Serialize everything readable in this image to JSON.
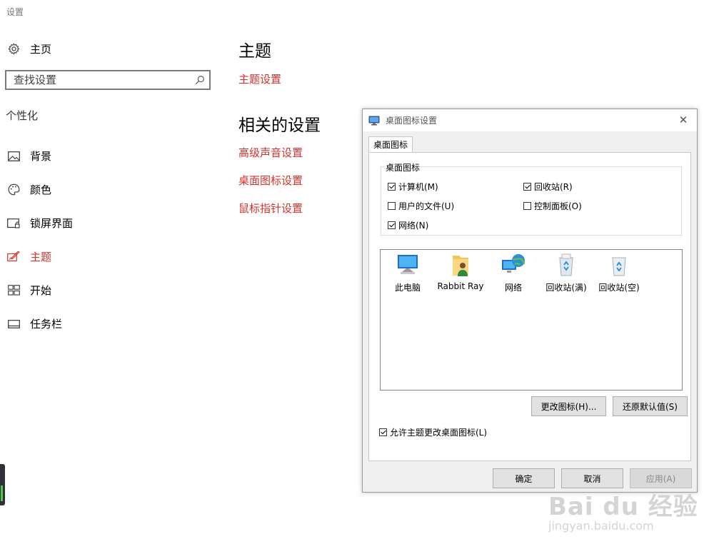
{
  "app": {
    "title": "设置"
  },
  "sidebar": {
    "home_label": "主页",
    "search_placeholder": "查找设置",
    "section_label": "个性化",
    "items": [
      {
        "label": "背景",
        "icon": "picture-icon"
      },
      {
        "label": "颜色",
        "icon": "palette-icon"
      },
      {
        "label": "锁屏界面",
        "icon": "lockscreen-icon"
      },
      {
        "label": "主题",
        "icon": "theme-brush-icon",
        "active": true
      },
      {
        "label": "开始",
        "icon": "start-tiles-icon"
      },
      {
        "label": "任务栏",
        "icon": "taskbar-icon"
      }
    ]
  },
  "main": {
    "title": "主题",
    "theme_settings_link": "主题设置",
    "related_title": "相关的设置",
    "related_links": [
      "高级声音设置",
      "桌面图标设置",
      "鼠标指针设置"
    ]
  },
  "dialog": {
    "title": "桌面图标设置",
    "close_glyph": "✕",
    "tab": "桌面图标",
    "group_label": "桌面图标",
    "checkboxes": {
      "computer": {
        "label": "计算机(M)",
        "checked": true
      },
      "recycle": {
        "label": "回收站(R)",
        "checked": true
      },
      "user_files": {
        "label": "用户的文件(U)",
        "checked": false
      },
      "control_panel": {
        "label": "控制面板(O)",
        "checked": false
      },
      "network": {
        "label": "网络(N)",
        "checked": true
      }
    },
    "icons": [
      {
        "label": "此电脑",
        "icon": "computer-icon"
      },
      {
        "label": "Rabbit Ray",
        "icon": "user-folder-icon"
      },
      {
        "label": "网络",
        "icon": "network-globe-icon"
      },
      {
        "label": "回收站(满)",
        "icon": "recycle-bin-full-icon"
      },
      {
        "label": "回收站(空)",
        "icon": "recycle-bin-empty-icon"
      }
    ],
    "change_icon_button": "更改图标(H)...",
    "restore_default_button": "还原默认值(S)",
    "allow_themes_checkbox": {
      "label": "允许主题更改桌面图标(L)",
      "checked": true
    },
    "ok_button": "确定",
    "cancel_button": "取消",
    "apply_button": "应用(A)"
  },
  "watermark": {
    "main": "Bai du 经验",
    "sub": "jingyan.baidu.com"
  },
  "colors": {
    "accent": "#d0332d",
    "dialog_bg": "#f0f0f0",
    "button_bg": "#e1e1e1"
  }
}
